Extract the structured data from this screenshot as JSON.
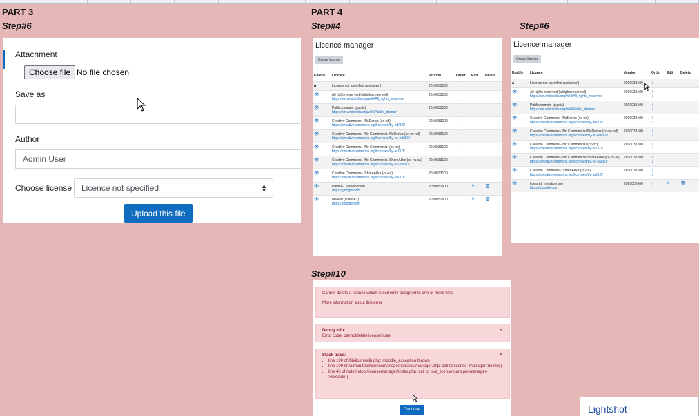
{
  "part3": {
    "title": "PART 3",
    "step": "Step#6",
    "form": {
      "attachment_label": "Attachment",
      "choose_file_button": "Choose file",
      "no_file_text": "No file chosen",
      "save_as_label": "Save as",
      "save_as_value": "",
      "author_label": "Author",
      "author_value": "Admin User",
      "choose_license_label": "Choose license",
      "license_selected": "Licence not specified",
      "upload_button": "Upload this file"
    }
  },
  "part4": {
    "title": "PART 4",
    "step_a": "Step#4",
    "step_b": "Step#6",
    "step_c": "Step#10",
    "heading": "Licence manager",
    "create_button": "Create licence",
    "columns": [
      "Enable",
      "Licence",
      "Version",
      "Order",
      "Edit",
      "Delete"
    ],
    "licences_a": [
      {
        "name": "Licence not specified (unknown)",
        "url": "",
        "version": "2010033100",
        "enable": "lock",
        "up": false,
        "down": true,
        "edit": false,
        "delete": false
      },
      {
        "name": "All rights reserved (allrightsreserved)",
        "url": "https://en.wikipedia.org/wiki/All_rights_reserved",
        "version": "2010033100",
        "enable": "eye",
        "up": true,
        "down": true,
        "edit": false,
        "delete": false
      },
      {
        "name": "Public domain (public)",
        "url": "https://en.wikipedia.org/wiki/Public_domain",
        "version": "2010033100",
        "enable": "eye",
        "up": true,
        "down": true,
        "edit": false,
        "delete": false
      },
      {
        "name": "Creative Commons - NoDerivs (cc-nd)",
        "url": "https://creativecommons.org/licenses/by-nd/3.0/",
        "version": "2010033100",
        "enable": "eye",
        "up": true,
        "down": true,
        "edit": false,
        "delete": false
      },
      {
        "name": "Creative Commons - No Commercial NoDerivs (cc-nc-nd)",
        "url": "https://creativecommons.org/licenses/by-nc-nd/3.0/",
        "version": "2010033100",
        "enable": "eye",
        "up": true,
        "down": true,
        "edit": false,
        "delete": false
      },
      {
        "name": "Creative Commons - No Commercial (cc-nc)",
        "url": "https://creativecommons.org/licenses/by-nc/3.0/",
        "version": "2010033100",
        "enable": "eye",
        "up": true,
        "down": true,
        "edit": false,
        "delete": false
      },
      {
        "name": "Creative Commons - No Commercial ShareAlike (cc-nc-sa)",
        "url": "https://creativecommons.org/licenses/by-nc-sa/3.0/",
        "version": "2010033100",
        "enable": "eye",
        "up": true,
        "down": true,
        "edit": false,
        "delete": false
      },
      {
        "name": "Creative Commons - ShareAlike (cc-sa)",
        "url": "https://creativecommons.org/licenses/by-sa/3.0/",
        "version": "2010033100",
        "enable": "eye",
        "up": true,
        "down": true,
        "edit": false,
        "delete": false
      },
      {
        "name": "license2 (newlicense)",
        "url": "https://google.com",
        "version": "2020052600",
        "enable": "eye",
        "up": true,
        "down": true,
        "edit": true,
        "delete": true
      },
      {
        "name": "newest (license3)",
        "url": "https://google.com",
        "version": "2020052600",
        "enable": "eye",
        "up": true,
        "down": false,
        "edit": true,
        "delete": true
      }
    ],
    "licences_b": [
      {
        "name": "Licence not specified (unknown)",
        "url": "",
        "version": "2010033100",
        "enable": "lock",
        "up": false,
        "down": true,
        "edit": false,
        "delete": false
      },
      {
        "name": "All rights reserved (allrightsreserved)",
        "url": "https://en.wikipedia.org/wiki/All_rights_reserved",
        "version": "2010033100",
        "enable": "eye",
        "up": true,
        "down": true,
        "edit": false,
        "delete": false
      },
      {
        "name": "Public domain (public)",
        "url": "https://en.wikipedia.org/wiki/Public_domain",
        "version": "2010033100",
        "enable": "eye",
        "up": true,
        "down": true,
        "edit": false,
        "delete": false
      },
      {
        "name": "Creative Commons - NoDerivs (cc-nd)",
        "url": "https://creativecommons.org/licenses/by-nd/3.0/",
        "version": "2010033100",
        "enable": "eye",
        "up": true,
        "down": true,
        "edit": false,
        "delete": false
      },
      {
        "name": "Creative Commons - No Commercial NoDerivs (cc-nc-nd)",
        "url": "https://creativecommons.org/licenses/by-nc-nd/3.0/",
        "version": "2010033100",
        "enable": "eye",
        "up": true,
        "down": true,
        "edit": false,
        "delete": false
      },
      {
        "name": "Creative Commons - No Commercial (cc-nc)",
        "url": "https://creativecommons.org/licenses/by-nc/3.0/",
        "version": "2010033100",
        "enable": "eye",
        "up": true,
        "down": true,
        "edit": false,
        "delete": false
      },
      {
        "name": "Creative Commons - No Commercial ShareAlike (cc-nc-sa)",
        "url": "https://creativecommons.org/licenses/by-nc-sa/3.0/",
        "version": "2010033100",
        "enable": "eye",
        "up": true,
        "down": true,
        "edit": false,
        "delete": false
      },
      {
        "name": "Creative Commons - ShareAlike (cc-sa)",
        "url": "https://creativecommons.org/licenses/by-sa/3.0/",
        "version": "2010033100",
        "enable": "eye",
        "up": true,
        "down": true,
        "edit": false,
        "delete": false
      },
      {
        "name": "license2 (newlicense)",
        "url": "https://google.com",
        "version": "2020052600",
        "enable": "eye",
        "up": true,
        "down": false,
        "edit": true,
        "delete": true
      }
    ],
    "error": {
      "message": "Cannot delete a licence which is currently assigned to one or more files",
      "more_info": "More information about this error",
      "debug_title": "Debug info:",
      "debug_code": "Error code: cannotdeletelicenseinuse",
      "stack_title": "Stack trace:",
      "stack": [
        "line 190 of /lib/licenselib.php: moodle_exception thrown",
        "line 109 of /admin/tool/licensemanager/classes/manager.php: call to license_manager::delete()",
        "line 46 of /admin/tool/licensemanager/index.php: call to tool_licensemanager\\manager->execute()"
      ],
      "continue_button": "Continue",
      "close_glyph": "×"
    }
  },
  "lightshot": {
    "label": "Lightshot"
  },
  "colors": {
    "background": "#e5b8b7",
    "primary": "#0f6cbf",
    "alert_bg": "#f8d7da"
  }
}
